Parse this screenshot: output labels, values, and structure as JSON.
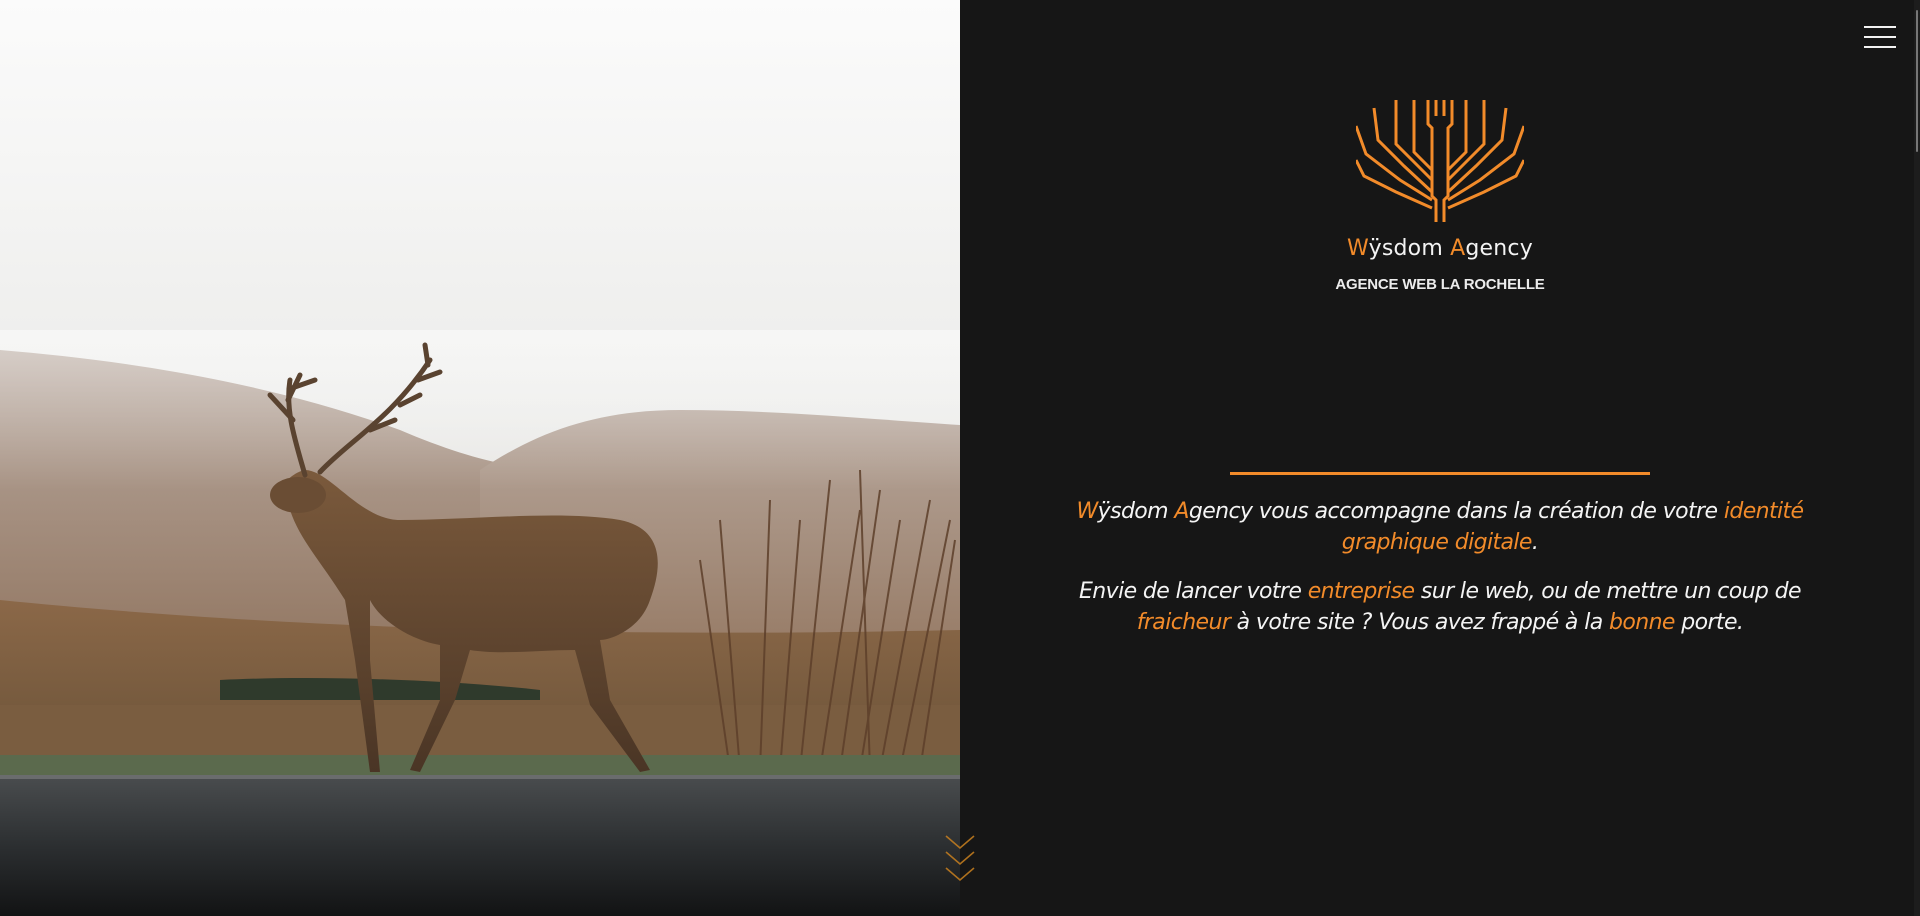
{
  "colors": {
    "background": "#161616",
    "accent": "#f28b2a",
    "text": "#f4f4f4"
  },
  "nav": {
    "menu_icon": "hamburger-icon"
  },
  "hero": {
    "image": "stag-in-misty-highlands-photo"
  },
  "brand": {
    "logo_icon": "tree-circuit-logo-icon",
    "name": {
      "w": "W",
      "ysdom": "ÿsdom ",
      "a": "A",
      "gency": "gency"
    },
    "tagline": "AGENCE WEB LA ROCHELLE"
  },
  "intro": {
    "p1": {
      "w": "W",
      "ysdom": "ÿsdom ",
      "a": "A",
      "t1": "gency vous accompagne dans la création de votre ",
      "h1": "identité graphique digitale",
      "t2": "."
    },
    "p2": {
      "t1": "Envie de lancer votre ",
      "h1": "entreprise",
      "t2": " sur le web, ou de mettre un coup de ",
      "h2": "fraicheur",
      "t3": " à votre site ? Vous avez frappé à la ",
      "h3": "bonne",
      "t4": " porte."
    }
  },
  "scroll_indicator": {
    "icon": "chevrons-down-icon"
  }
}
